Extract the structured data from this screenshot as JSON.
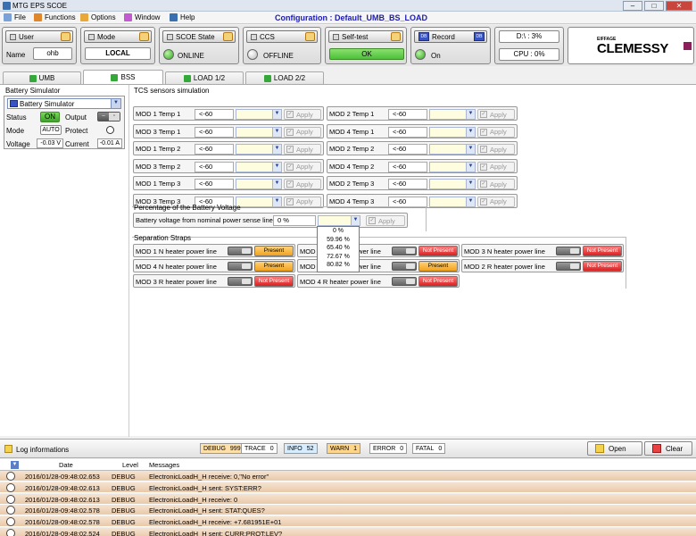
{
  "window": {
    "title": "MTG EPS SCOE",
    "controls": [
      "–",
      "□",
      "✕"
    ]
  },
  "menu": {
    "items": [
      "File",
      "Functions",
      "Options",
      "Window",
      "Help"
    ],
    "configuration": "Configuration : Default_UMB_BS_LOAD"
  },
  "toolbar": {
    "user": {
      "label": "User",
      "name_label": "Name",
      "name_value": "ohb"
    },
    "mode": {
      "label": "Mode",
      "value": "LOCAL"
    },
    "scoe_state": {
      "label": "SCOE State",
      "value": "ONLINE"
    },
    "ccs": {
      "label": "CCS",
      "value": "OFFLINE"
    },
    "self_test": {
      "label": "Self-test",
      "value": "OK"
    },
    "record": {
      "label": "Record",
      "value": "On"
    },
    "disk": "D:\\ : 3%",
    "cpu": "CPU : 0%",
    "logo_small": "EIFFAGE",
    "logo_big": "CLEMESSY"
  },
  "tabs": [
    "UMB",
    "BSS",
    "LOAD 1/2",
    "LOAD 2/2"
  ],
  "battery": {
    "section": "Battery Simulator",
    "selected": "Battery Simulator",
    "status_label": "Status",
    "status_value": "ON",
    "output_label": "Output",
    "mode_label": "Mode",
    "mode_value": "AUTO",
    "protect_label": "Protect",
    "voltage_label": "Voltage",
    "voltage_value": "-0.03 V",
    "current_label": "Current",
    "current_value": "-0.01 A"
  },
  "tcs": {
    "section": "TCS sensors simulation",
    "apply": "Apply",
    "rows": [
      {
        "left": "MOD 1 Temp 1",
        "lv": "<-60",
        "right": "MOD 2 Temp 1",
        "rv": "<-60"
      },
      {
        "left": "MOD 3 Temp 1",
        "lv": "<-60",
        "right": "MOD 4 Temp 1",
        "rv": "<-60"
      },
      {
        "left": "MOD 1 Temp 2",
        "lv": "<-60",
        "right": "MOD 2 Temp 2",
        "rv": "<-60"
      },
      {
        "left": "MOD 3 Temp 2",
        "lv": "<-60",
        "right": "MOD 4 Temp 2",
        "rv": "<-60"
      },
      {
        "left": "MOD 1 Temp 3",
        "lv": "<-60",
        "right": "MOD 2 Temp 3",
        "rv": "<-60"
      },
      {
        "left": "MOD 3 Temp 3",
        "lv": "<-60",
        "right": "MOD 4 Temp 3",
        "rv": "<-60"
      }
    ]
  },
  "voltage_pct": {
    "section": "Percentage of the Battery Voltage",
    "label": "Battery voltage from nominal power sense lines",
    "value": "0 %",
    "apply": "Apply",
    "options": [
      "0 %",
      "59.96 %",
      "65.40 %",
      "72.67 %",
      "80.82 %"
    ]
  },
  "straps": {
    "section": "Separation Straps",
    "rows": [
      [
        {
          "label": "MOD 1 N heater power line",
          "state": "Present"
        },
        {
          "label": "MOD 2 N heater power line",
          "state": "Not Present"
        },
        {
          "label": "MOD 3 N heater power line",
          "state": "Not Present"
        }
      ],
      [
        {
          "label": "MOD 4 N heater power line",
          "state": "Present"
        },
        {
          "label": "MOD 1 R heater power line",
          "state": "Present"
        },
        {
          "label": "MOD 2 R heater power line",
          "state": "Not Present"
        }
      ],
      [
        {
          "label": "MOD 3 R heater power line",
          "state": "Not Present"
        },
        {
          "label": "MOD 4 R heater power line",
          "state": "Not Present"
        }
      ]
    ]
  },
  "log": {
    "title": "Log informations",
    "levels": [
      {
        "name": "DEBUG",
        "count": "999+"
      },
      {
        "name": "TRACE",
        "count": "0"
      },
      {
        "name": "INFO",
        "count": "52"
      },
      {
        "name": "WARN",
        "count": "1"
      },
      {
        "name": "ERROR",
        "count": "0"
      },
      {
        "name": "FATAL",
        "count": "0"
      }
    ],
    "open": "Open",
    "clear": "Clear",
    "headers": [
      "Date",
      "Level",
      "Messages"
    ],
    "rows": [
      {
        "date": "2016/01/28-09:48:02.653",
        "level": "DEBUG",
        "msg": "ElectronicLoadH_H receive: 0,\"No error\""
      },
      {
        "date": "2016/01/28-09:48:02.613",
        "level": "DEBUG",
        "msg": "ElectronicLoadH_H sent: SYST:ERR?"
      },
      {
        "date": "2016/01/28-09:48:02.613",
        "level": "DEBUG",
        "msg": "ElectronicLoadH_H receive: 0"
      },
      {
        "date": "2016/01/28-09:48:02.578",
        "level": "DEBUG",
        "msg": "ElectronicLoadH_H sent: STAT:QUES?"
      },
      {
        "date": "2016/01/28-09:48:02.578",
        "level": "DEBUG",
        "msg": "ElectronicLoadH_H receive: +7.681951E+01"
      },
      {
        "date": "2016/01/28-09:48:02.524",
        "level": "DEBUG",
        "msg": "ElectronicLoadH_H sent: CURR:PROT:LEV?"
      }
    ]
  }
}
